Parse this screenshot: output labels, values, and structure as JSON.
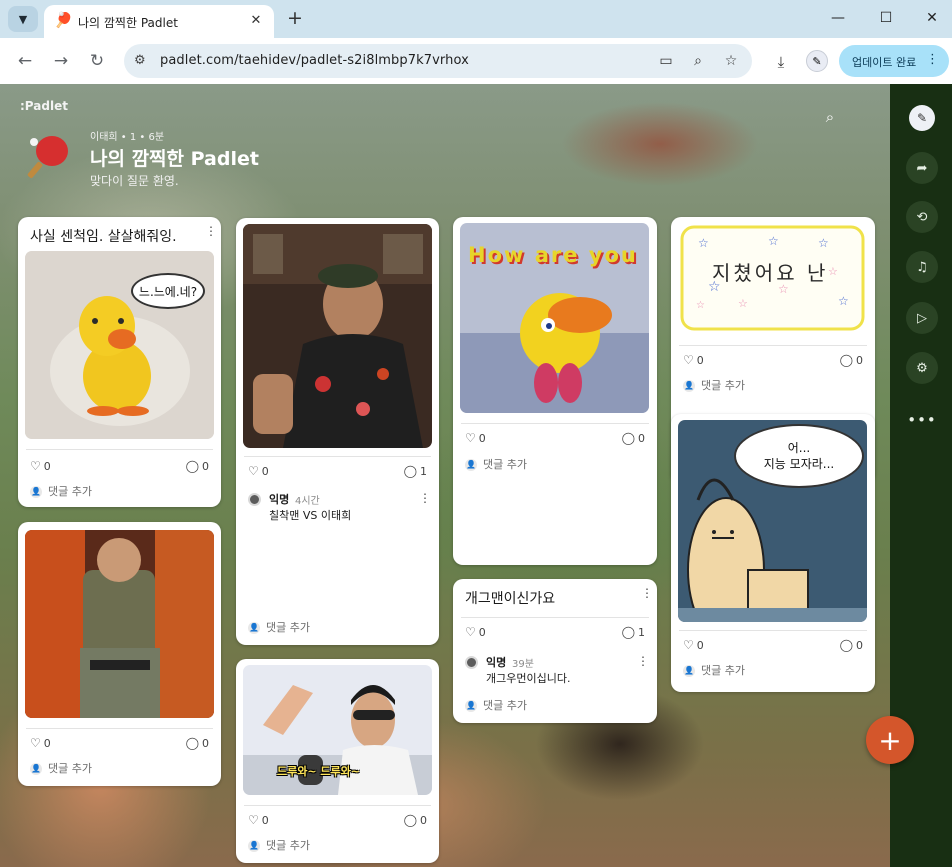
{
  "browser": {
    "tab_title": "나의 깜찍한 Padlet",
    "tab_favicon": "🏓",
    "url": "padlet.com/taehidev/padlet-s2i8lmbp7k7vrhox",
    "update_label": "업데이트 완료",
    "icons": [
      "chevron-down-icon",
      "close-icon",
      "plus-icon",
      "minimize-icon",
      "maximize-icon",
      "back-icon",
      "forward-icon",
      "reload-icon",
      "site-info-icon",
      "install-icon",
      "zoom-icon",
      "star-icon",
      "download-icon",
      "profile-icon",
      "more-icon"
    ]
  },
  "padlet": {
    "brand": ":Padlet",
    "meta": "이태희 • 1 • 6분",
    "title": "나의 깜찍한 Padlet",
    "subtitle": "맞다이 질문 환영.",
    "add_comment": "댓글 추가",
    "accent_color": "#d4562b",
    "sidebar_color": "#182f13"
  },
  "cards": {
    "c1": {
      "title": "사실 센척임. 살살해줘잉.",
      "likes": "0",
      "comments": "0",
      "bubble": "느.느에.네?"
    },
    "c2": {
      "likes": "0",
      "comments": "1",
      "comment_author": "익명",
      "comment_time": "4시간",
      "comment_text": "칠착맨 VS 이태희"
    },
    "c3": {
      "likes": "0",
      "comments": "0",
      "banner": "How are you"
    },
    "c4": {
      "likes": "0",
      "comments": "0",
      "drawing_text": "지쳤어요 난"
    },
    "c5": {
      "likes": "0",
      "comments": "0"
    },
    "c6": {
      "likes": "0",
      "comments": "0",
      "caption": "드루와~ 드루와~"
    },
    "c7": {
      "title": "개그맨이신가요",
      "likes": "0",
      "comments": "1",
      "comment_author": "익명",
      "comment_time": "39분",
      "comment_text": "개그우먼이십니다."
    },
    "c8": {
      "likes": "0",
      "comments": "0",
      "bubble": "어...\n지능 모자라..."
    }
  }
}
